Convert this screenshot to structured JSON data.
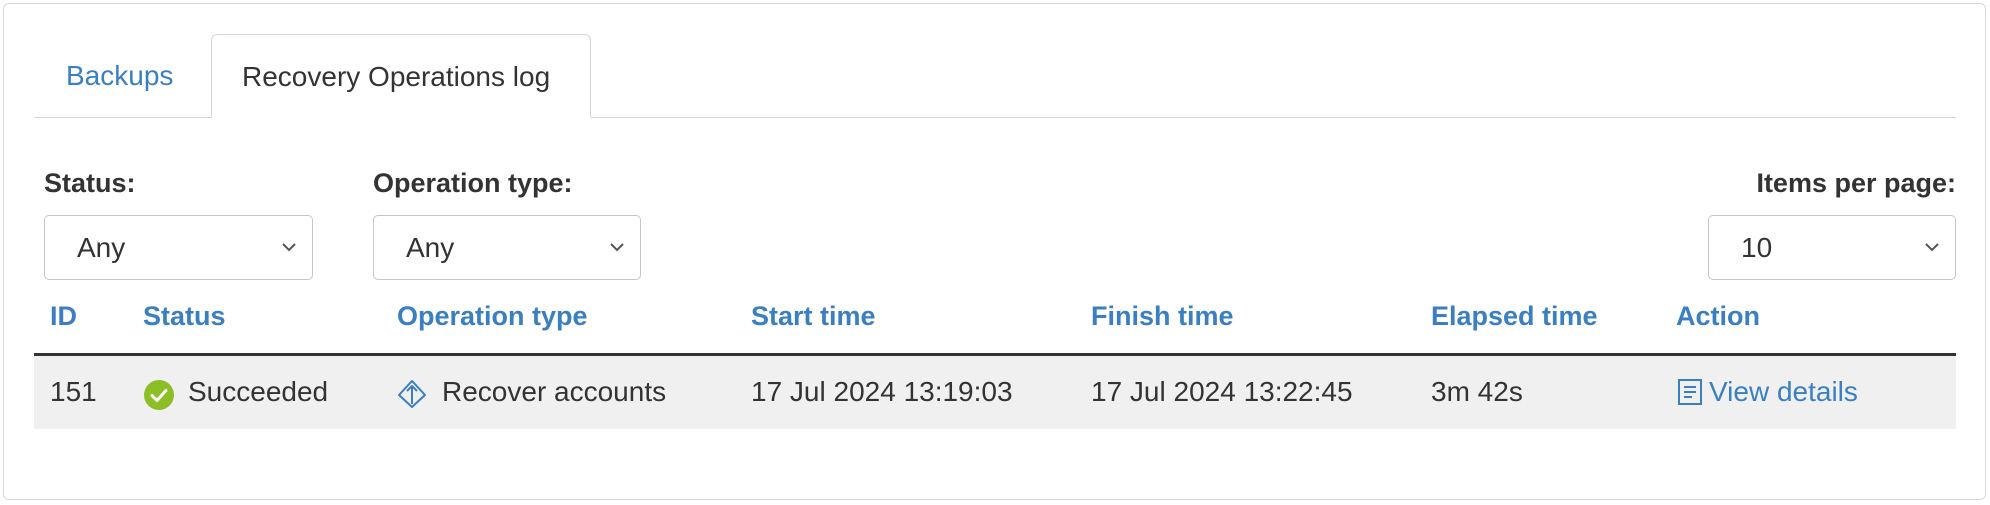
{
  "tabs": [
    {
      "label": "Backups",
      "active": false
    },
    {
      "label": "Recovery Operations log",
      "active": true
    }
  ],
  "filters": {
    "status": {
      "label": "Status:",
      "value": "Any"
    },
    "operation_type": {
      "label": "Operation type:",
      "value": "Any"
    },
    "items_per_page": {
      "label": "Items per page:",
      "value": "10"
    }
  },
  "table": {
    "columns": [
      "ID",
      "Status",
      "Operation type",
      "Start time",
      "Finish time",
      "Elapsed time",
      "Action"
    ],
    "rows": [
      {
        "id": "151",
        "status": "Succeeded",
        "status_icon": "check-circle-icon",
        "operation_type": "Recover accounts",
        "operation_icon": "recover-icon",
        "start_time": "17 Jul 2024 13:19:03",
        "finish_time": "17 Jul 2024 13:22:45",
        "elapsed_time": "3m 42s",
        "action": "View details",
        "action_icon": "log-icon"
      }
    ]
  },
  "colors": {
    "link": "#3a7fc1",
    "success": "#8cbf26",
    "row_bg": "#f0f0f0",
    "header_rule": "#333333"
  }
}
